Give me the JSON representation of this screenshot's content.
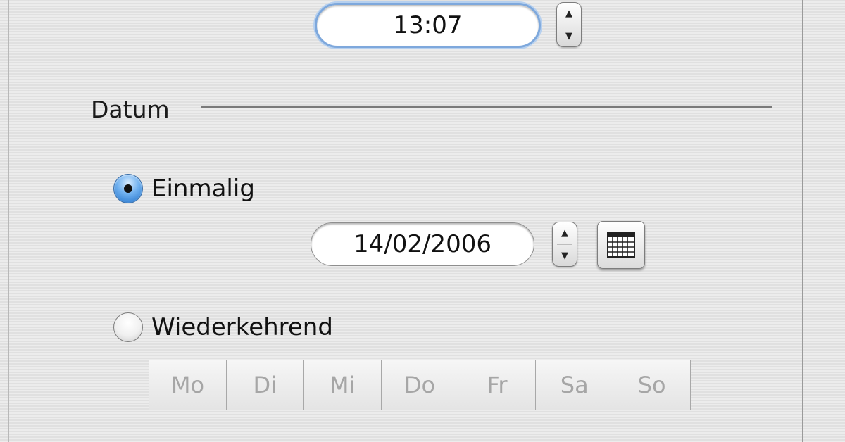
{
  "time": {
    "value": "13:07",
    "stepper_up": "▲",
    "stepper_down": "▼"
  },
  "date_section": {
    "title": "Datum",
    "once": {
      "label": "Einmalig",
      "selected": true,
      "date_value": "14/02/2006",
      "stepper_up": "▲",
      "stepper_down": "▼"
    },
    "recurring": {
      "label": "Wiederkehrend",
      "selected": false,
      "days": [
        "Mo",
        "Di",
        "Mi",
        "Do",
        "Fr",
        "Sa",
        "So"
      ]
    }
  },
  "icons": {
    "calendar": "calendar-icon",
    "radio_selected": "radio-selected-icon",
    "radio_unselected": "radio-unselected-icon"
  },
  "colors": {
    "focus_ring": "#7ea8dc",
    "radio_selected": "#2f7fd6",
    "disabled_text": "#a6a6a6"
  }
}
